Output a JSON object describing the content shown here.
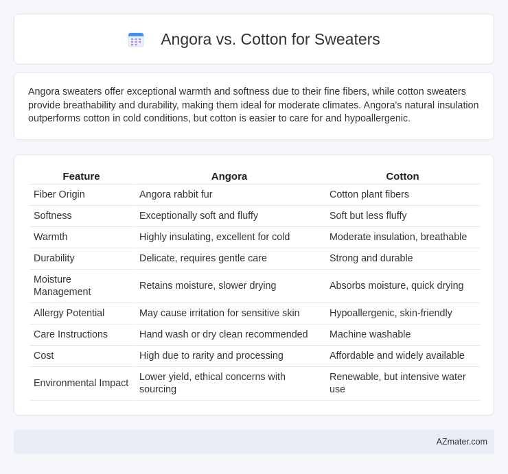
{
  "header": {
    "title": "Angora vs. Cotton for Sweaters",
    "icon": "calendar-icon",
    "icon_colors": {
      "top": "#4b8ef0",
      "body": "#eef0fb",
      "dots": "#a98ddb"
    }
  },
  "summary": {
    "text": "Angora sweaters offer exceptional warmth and softness due to their fine fibers, while cotton sweaters provide breathability and durability, making them ideal for moderate climates. Angora's natural insulation outperforms cotton in cold conditions, but cotton is easier to care for and hypoallergenic."
  },
  "table": {
    "headers": [
      "Feature",
      "Angora",
      "Cotton"
    ],
    "rows": [
      [
        "Fiber Origin",
        "Angora rabbit fur",
        "Cotton plant fibers"
      ],
      [
        "Softness",
        "Exceptionally soft and fluffy",
        "Soft but less fluffy"
      ],
      [
        "Warmth",
        "Highly insulating, excellent for cold",
        "Moderate insulation, breathable"
      ],
      [
        "Durability",
        "Delicate, requires gentle care",
        "Strong and durable"
      ],
      [
        "Moisture Management",
        "Retains moisture, slower drying",
        "Absorbs moisture, quick drying"
      ],
      [
        "Allergy Potential",
        "May cause irritation for sensitive skin",
        "Hypoallergenic, skin-friendly"
      ],
      [
        "Care Instructions",
        "Hand wash or dry clean recommended",
        "Machine washable"
      ],
      [
        "Cost",
        "High due to rarity and processing",
        "Affordable and widely available"
      ],
      [
        "Environmental Impact",
        "Lower yield, ethical concerns with sourcing",
        "Renewable, but intensive water use"
      ]
    ]
  },
  "footer": {
    "text": "AZmater.com"
  }
}
